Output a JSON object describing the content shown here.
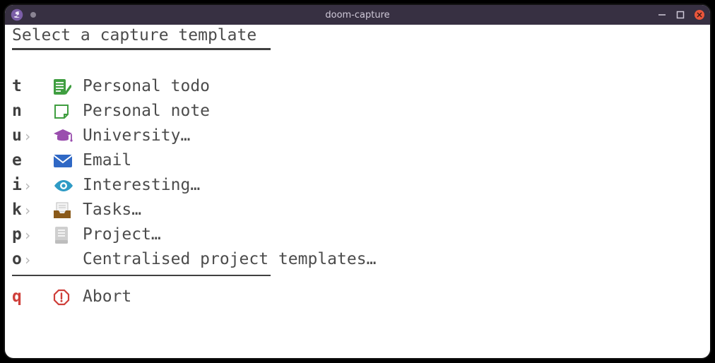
{
  "window": {
    "title": "doom-capture"
  },
  "header": {
    "title": "Select a capture template"
  },
  "items": [
    {
      "key": "t",
      "submenu": false,
      "icon": "checklist",
      "label": "Personal todo"
    },
    {
      "key": "n",
      "submenu": false,
      "icon": "note",
      "label": "Personal note"
    },
    {
      "key": "u",
      "submenu": true,
      "icon": "gradcap",
      "label": "University…"
    },
    {
      "key": "e",
      "submenu": false,
      "icon": "envelope",
      "label": "Email"
    },
    {
      "key": "i",
      "submenu": true,
      "icon": "eye",
      "label": "Interesting…"
    },
    {
      "key": "k",
      "submenu": true,
      "icon": "inbox",
      "label": "Tasks…"
    },
    {
      "key": "p",
      "submenu": true,
      "icon": "book",
      "label": "Project…"
    },
    {
      "key": "o",
      "submenu": true,
      "icon": "",
      "label": "Centralised project templates…"
    }
  ],
  "abort": {
    "key": "q",
    "label": "Abort"
  },
  "colors": {
    "checklist": "#3f9e40",
    "note_border": "#3f9e40",
    "gradcap": "#9a4eae",
    "envelope": "#2f68c5",
    "eye": "#2f9bc5",
    "inbox_body": "#8a5a1a",
    "inbox_paper": "#efefef",
    "book": "#cfcfcf",
    "abort": "#cf3f3a"
  }
}
